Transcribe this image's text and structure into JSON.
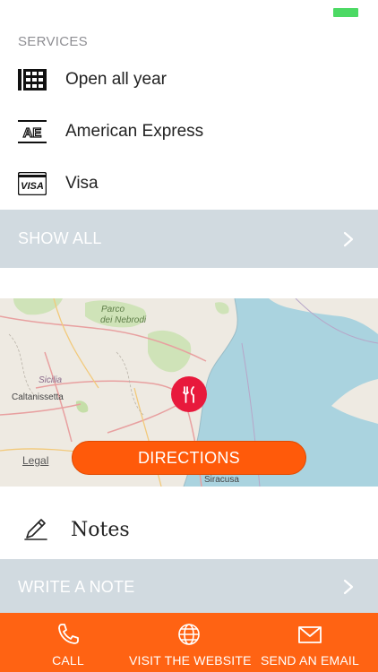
{
  "services": {
    "title": "SERVICES",
    "items": [
      {
        "icon": "calendar-grid-icon",
        "label": "Open all year"
      },
      {
        "icon": "american-express-card-icon",
        "label": "American Express"
      },
      {
        "icon": "visa-card-icon",
        "label": "Visa"
      }
    ],
    "show_all_label": "SHOW ALL"
  },
  "map": {
    "labels": {
      "parco": "Parco",
      "nebrodi": "dei Nebrodi",
      "sicilia": "Sicilia",
      "caltanissetta": "Caltanissetta",
      "siracusa": "Siracusa"
    },
    "legal_label": "Legal",
    "marker_icon": "fork-knife-icon",
    "directions_label": "DIRECTIONS"
  },
  "notes": {
    "icon": "pencil-icon",
    "label": "Notes",
    "write_label": "WRITE A NOTE"
  },
  "actions": [
    {
      "icon": "phone-icon",
      "label": "CALL"
    },
    {
      "icon": "globe-icon",
      "label": "VISIT THE WEBSITE"
    },
    {
      "icon": "mail-icon",
      "label": "SEND AN EMAIL"
    }
  ],
  "colors": {
    "accent": "#ff6313",
    "bar": "#d1dae0",
    "battery": "#4cd964",
    "marker": "#e8193c"
  }
}
